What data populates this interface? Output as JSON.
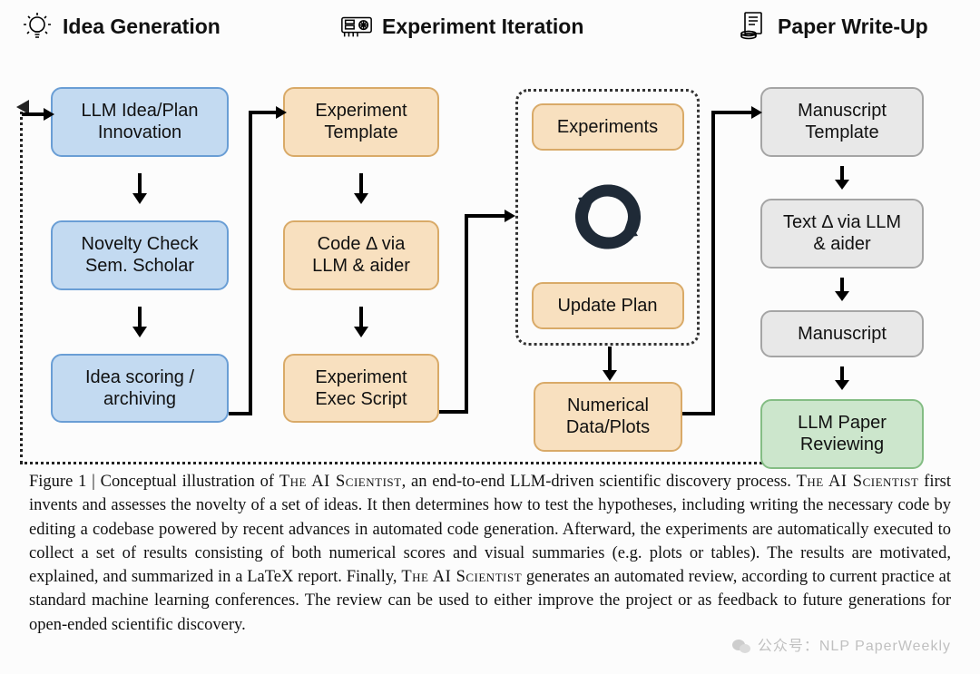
{
  "headers": {
    "idea": "Idea Generation",
    "experiment": "Experiment Iteration",
    "paper": "Paper Write-Up"
  },
  "col1": {
    "n1": "LLM Idea/Plan Innovation",
    "n2": "Novelty Check Sem. Scholar",
    "n3": "Idea scoring / archiving"
  },
  "col2": {
    "n1": "Experiment Template",
    "n2": "Code Δ via LLM & aider",
    "n3": "Experiment Exec Script"
  },
  "col3": {
    "n1": "Experiments",
    "n2": "Update Plan",
    "out": "Numerical Data/Plots"
  },
  "col4": {
    "n1": "Manuscript Template",
    "n2": "Text Δ via LLM & aider",
    "n3": "Manuscript",
    "n4": "LLM Paper Reviewing"
  },
  "caption": {
    "label": "Figure 1",
    "sep": " | ",
    "pre": "Conceptual illustration of ",
    "sc1": "The AI Scientist",
    "mid1": ", an end-to-end LLM-driven scientific discovery process. ",
    "sc2": "The AI Scientist",
    "mid2": " first invents and assesses the novelty of a set of ideas. It then determines how to test the hypotheses, including writing the necessary code by editing a codebase powered by recent advances in automated code generation. Afterward, the experiments are automatically executed to collect a set of results consisting of both numerical scores and visual summaries (e.g. plots or tables). The results are motivated, explained, and summarized in a LaTeX report. Finally, ",
    "sc3": "The AI Scientist",
    "mid3": " generates an automated review, according to current practice at standard machine learning conferences. The review can be used to either improve the project or as feedback to future generations for open-ended scientific discovery."
  },
  "watermark": {
    "prefix": "公众号：",
    "name": "NLP PaperWeekly"
  },
  "chart_data": {
    "type": "diagram",
    "title": "Conceptual illustration of The AI Scientist: end-to-end LLM-driven scientific discovery process",
    "stages": [
      {
        "name": "Idea Generation",
        "icon": "lightbulb-icon",
        "nodes": [
          {
            "id": "idea-plan",
            "label": "LLM Idea/Plan Innovation",
            "color": "blue"
          },
          {
            "id": "novelty-check",
            "label": "Novelty Check Sem. Scholar",
            "color": "blue"
          },
          {
            "id": "idea-scoring",
            "label": "Idea scoring / archiving",
            "color": "blue"
          }
        ]
      },
      {
        "name": "Experiment Iteration",
        "icon": "gpu-icon",
        "nodes": [
          {
            "id": "exp-template",
            "label": "Experiment Template",
            "color": "tan"
          },
          {
            "id": "code-delta",
            "label": "Code Δ via LLM & aider",
            "color": "tan"
          },
          {
            "id": "exec-script",
            "label": "Experiment Exec Script",
            "color": "tan"
          },
          {
            "id": "experiments",
            "label": "Experiments",
            "color": "tan",
            "in_loop": true
          },
          {
            "id": "update-plan",
            "label": "Update Plan",
            "color": "tan",
            "in_loop": true
          },
          {
            "id": "numerical-data",
            "label": "Numerical Data/Plots",
            "color": "tan"
          }
        ]
      },
      {
        "name": "Paper Write-Up",
        "icon": "papers-icon",
        "nodes": [
          {
            "id": "manuscript-template",
            "label": "Manuscript Template",
            "color": "gray"
          },
          {
            "id": "text-delta",
            "label": "Text Δ via LLM & aider",
            "color": "gray"
          },
          {
            "id": "manuscript",
            "label": "Manuscript",
            "color": "gray"
          },
          {
            "id": "paper-review",
            "label": "LLM Paper Reviewing",
            "color": "green"
          }
        ]
      }
    ],
    "edges": [
      {
        "from": "idea-plan",
        "to": "novelty-check"
      },
      {
        "from": "novelty-check",
        "to": "idea-scoring"
      },
      {
        "from": "idea-scoring",
        "to": "exp-template",
        "routing": "up-right"
      },
      {
        "from": "exp-template",
        "to": "code-delta"
      },
      {
        "from": "code-delta",
        "to": "exec-script"
      },
      {
        "from": "exec-script",
        "to": "experiments",
        "routing": "up-right-into-loop"
      },
      {
        "from": "experiments",
        "to": "update-plan",
        "type": "cycle"
      },
      {
        "from": "update-plan",
        "to": "experiments",
        "type": "cycle"
      },
      {
        "from": "experiments-loop",
        "to": "numerical-data"
      },
      {
        "from": "numerical-data",
        "to": "manuscript-template",
        "routing": "up-right"
      },
      {
        "from": "manuscript-template",
        "to": "text-delta"
      },
      {
        "from": "text-delta",
        "to": "manuscript"
      },
      {
        "from": "manuscript",
        "to": "paper-review"
      },
      {
        "from": "paper-review",
        "to": "idea-plan",
        "style": "dotted",
        "routing": "feedback-loop"
      }
    ],
    "color_legend": {
      "blue": "#c3daf1",
      "tan": "#f8e0bf",
      "gray": "#e8e8e8",
      "green": "#cce6cc"
    }
  }
}
